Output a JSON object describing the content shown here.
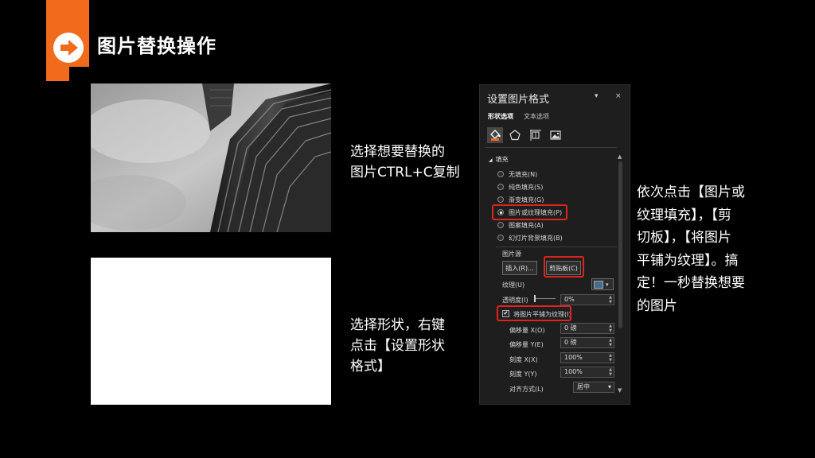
{
  "header": {
    "title": "图片替换操作"
  },
  "steps": {
    "step1": "选择想要替换的\n图片CTRL+C复制",
    "step2": "选择形状，右键\n点击【设置形状\n格式】",
    "step3": "依次点击【图片或\n纹理填充】，【剪\n切板】，【将图片\n平铺为纹理】。搞\n定！一秒替换想要\n的图片"
  },
  "panel": {
    "title": "设置图片格式",
    "pin_glyph": "▾",
    "close_glyph": "×",
    "tabs": [
      "形状选项",
      "文本选项"
    ],
    "fill_section": {
      "toggle": "◢",
      "label": "填充"
    },
    "fill_options": [
      {
        "label": "无填充(N)",
        "selected": false
      },
      {
        "label": "纯色填充(S)",
        "selected": false
      },
      {
        "label": "渐变填充(G)",
        "selected": false
      },
      {
        "label": "图片或纹理填充(P)",
        "selected": true
      },
      {
        "label": "图案填充(A)",
        "selected": false
      },
      {
        "label": "幻灯片背景填充(B)",
        "selected": false
      }
    ],
    "picture_source_label": "图片源",
    "insert_button": "插入(R)...",
    "clipboard_button": "剪贴板(C)",
    "texture_label": "纹理(U)",
    "texture_dropdown_glyph": "▾",
    "transparency_label": "透明度(I)",
    "transparency_value": "0%",
    "tile_checkbox_label": "将图片平铺为纹理(I)",
    "tile_checked": true,
    "check_glyph": "✔",
    "spin_glyph": "▲\n▼",
    "scroll_up_glyph": "▲",
    "scroll_down_glyph": "▼",
    "offset_x": {
      "label": "偏移量 X(O)",
      "value": "0 磅"
    },
    "offset_y": {
      "label": "偏移量 Y(E)",
      "value": "0 磅"
    },
    "scale_x": {
      "label": "刻度 X(X)",
      "value": "100%"
    },
    "scale_y": {
      "label": "刻度 Y(Y)",
      "value": "100%"
    },
    "align": {
      "label": "对齐方式(L)",
      "value": "居中",
      "dropdown_glyph": "▾"
    }
  },
  "colors": {
    "accent": "#f26b1d",
    "highlight": "#e0241b"
  },
  "icons": [
    "arrow-right-icon",
    "paint-bucket-icon",
    "pentagon-icon",
    "size-layout-icon",
    "picture-icon",
    "pin-icon",
    "close-icon"
  ]
}
